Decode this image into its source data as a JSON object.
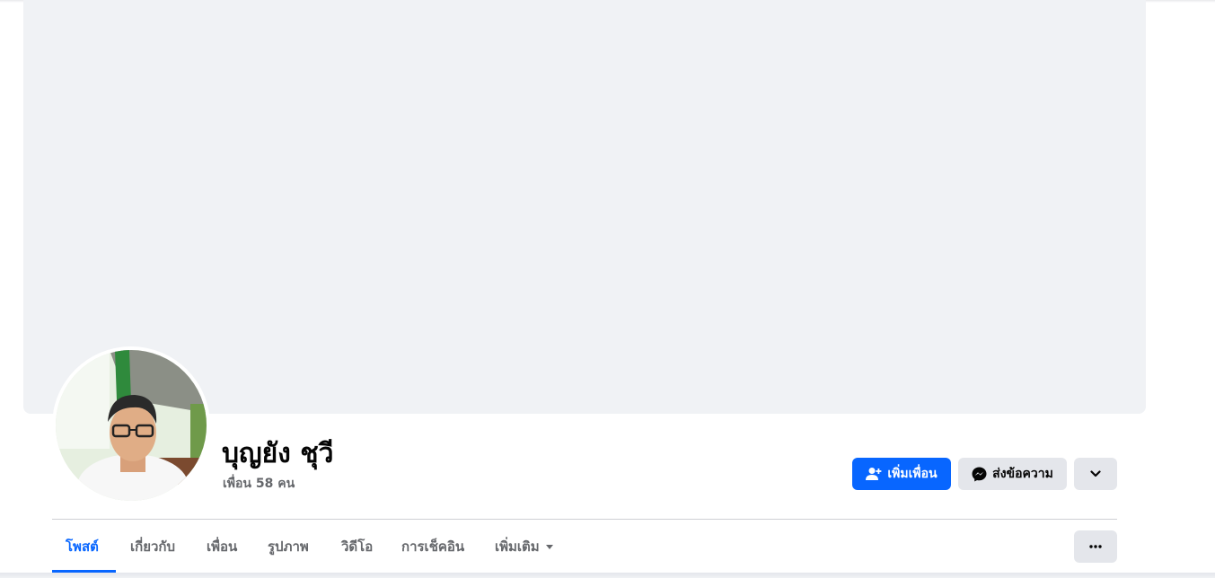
{
  "profile": {
    "name": "บุญยัง ชุวี",
    "friends_text": "เพื่อน 58 คน"
  },
  "actions": {
    "add_friend_label": "เพิ่มเพื่อน",
    "message_label": "ส่งข้อความ"
  },
  "tabs": [
    {
      "label": "โพสต์",
      "active": true
    },
    {
      "label": "เกี่ยวกับ",
      "active": false
    },
    {
      "label": "เพื่อน",
      "active": false
    },
    {
      "label": "รูปภาพ",
      "active": false
    },
    {
      "label": "วิดีโอ",
      "active": false
    },
    {
      "label": "การเช็คอิน",
      "active": false
    },
    {
      "label": "เพิ่มเติม",
      "active": false
    }
  ],
  "colors": {
    "accent": "#0866ff",
    "cover": "#f0f2f5",
    "button_secondary": "#e4e6eb",
    "text_primary": "#050505",
    "text_secondary": "#65676b"
  },
  "icons": {
    "add_friend": "person-plus-icon",
    "message": "messenger-icon",
    "dropdown": "chevron-down-icon",
    "more": "ellipsis-icon",
    "tab_more": "caret-down-icon"
  }
}
